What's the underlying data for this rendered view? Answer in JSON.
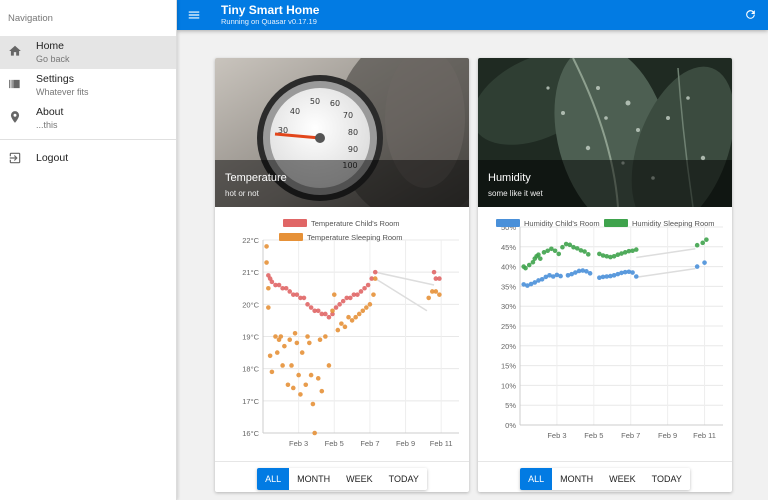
{
  "drawer": {
    "header": "Navigation",
    "items": [
      {
        "label": "Home",
        "sub": "Go back",
        "icon": "home-icon"
      },
      {
        "label": "Settings",
        "sub": "Whatever fits",
        "icon": "settings-icon"
      },
      {
        "label": "About",
        "sub": "...this",
        "icon": "location-pin-icon"
      }
    ],
    "logout": {
      "label": "Logout",
      "icon": "logout-icon"
    }
  },
  "header": {
    "title": "Tiny Smart Home",
    "subtitle": "Running on Quasar v0.17.19",
    "menu_icon": "menu-icon",
    "refresh_icon": "refresh-icon",
    "color": "#027be3"
  },
  "cards": {
    "temperature": {
      "title": "Temperature",
      "subtitle": "hot or not"
    },
    "humidity": {
      "title": "Humidity",
      "subtitle": "some like it wet"
    }
  },
  "range_buttons": [
    "ALL",
    "MONTH",
    "WEEK",
    "TODAY"
  ],
  "chart_data": [
    {
      "type": "scatter",
      "legend_position": "top",
      "grid": true,
      "x_ticks": [
        "Feb 3",
        "Feb 5",
        "Feb 7",
        "Feb 9",
        "Feb 11"
      ],
      "xlim": [
        "Feb 1",
        "Feb 12"
      ],
      "y_ticks": [
        "16°C",
        "17°C",
        "18°C",
        "19°C",
        "20°C",
        "21°C",
        "22°C"
      ],
      "ylim": [
        16,
        22
      ],
      "series": [
        {
          "name": "Temperature Child's Room",
          "color": "#e06666",
          "points": [
            [
              1.3,
              20.9
            ],
            [
              1.4,
              20.8
            ],
            [
              1.5,
              20.7
            ],
            [
              1.7,
              20.6
            ],
            [
              1.9,
              20.6
            ],
            [
              2.1,
              20.5
            ],
            [
              2.3,
              20.5
            ],
            [
              2.5,
              20.4
            ],
            [
              2.7,
              20.3
            ],
            [
              2.9,
              20.3
            ],
            [
              3.1,
              20.2
            ],
            [
              3.3,
              20.2
            ],
            [
              3.5,
              20.0
            ],
            [
              3.7,
              19.9
            ],
            [
              3.9,
              19.8
            ],
            [
              4.1,
              19.8
            ],
            [
              4.3,
              19.7
            ],
            [
              4.5,
              19.7
            ],
            [
              4.7,
              19.6
            ],
            [
              4.9,
              19.7
            ],
            [
              5.1,
              19.9
            ],
            [
              5.3,
              20.0
            ],
            [
              5.5,
              20.1
            ],
            [
              5.7,
              20.2
            ],
            [
              5.9,
              20.2
            ],
            [
              6.1,
              20.3
            ],
            [
              6.3,
              20.3
            ],
            [
              6.5,
              20.4
            ],
            [
              6.7,
              20.5
            ],
            [
              6.9,
              20.6
            ],
            [
              7.1,
              20.8
            ],
            [
              7.3,
              21.0
            ],
            [
              10.6,
              21.0
            ],
            [
              10.7,
              20.8
            ],
            [
              10.9,
              20.8
            ]
          ],
          "trend": [
            [
              7.3,
              21.0
            ],
            [
              10.6,
              20.6
            ]
          ]
        },
        {
          "name": "Temperature Sleeping Room",
          "color": "#e69138",
          "points": [
            [
              1.2,
              21.8
            ],
            [
              1.2,
              21.3
            ],
            [
              1.3,
              20.5
            ],
            [
              1.3,
              19.9
            ],
            [
              1.4,
              18.4
            ],
            [
              1.5,
              17.9
            ],
            [
              1.7,
              19.0
            ],
            [
              1.8,
              18.5
            ],
            [
              1.9,
              18.9
            ],
            [
              2.0,
              19.0
            ],
            [
              2.1,
              18.1
            ],
            [
              2.2,
              18.7
            ],
            [
              2.4,
              17.5
            ],
            [
              2.5,
              18.9
            ],
            [
              2.6,
              18.1
            ],
            [
              2.7,
              17.4
            ],
            [
              2.8,
              19.1
            ],
            [
              2.9,
              18.8
            ],
            [
              3.0,
              17.8
            ],
            [
              3.1,
              17.2
            ],
            [
              3.2,
              18.5
            ],
            [
              3.4,
              17.5
            ],
            [
              3.5,
              19.0
            ],
            [
              3.6,
              18.8
            ],
            [
              3.7,
              17.8
            ],
            [
              3.8,
              16.9
            ],
            [
              3.9,
              16.0
            ],
            [
              4.1,
              17.7
            ],
            [
              4.2,
              18.9
            ],
            [
              4.3,
              17.3
            ],
            [
              4.5,
              19.0
            ],
            [
              4.7,
              18.1
            ],
            [
              4.9,
              19.8
            ],
            [
              5.0,
              20.3
            ],
            [
              5.2,
              19.2
            ],
            [
              5.4,
              19.4
            ],
            [
              5.6,
              19.3
            ],
            [
              5.8,
              19.6
            ],
            [
              6.0,
              19.5
            ],
            [
              6.2,
              19.6
            ],
            [
              6.4,
              19.7
            ],
            [
              6.6,
              19.8
            ],
            [
              6.8,
              19.9
            ],
            [
              7.0,
              20.0
            ],
            [
              7.2,
              20.3
            ],
            [
              7.3,
              20.8
            ],
            [
              10.3,
              20.2
            ],
            [
              10.5,
              20.4
            ],
            [
              10.7,
              20.4
            ],
            [
              10.9,
              20.3
            ]
          ],
          "trend": [
            [
              7.3,
              20.8
            ],
            [
              10.2,
              19.8
            ]
          ]
        }
      ]
    },
    {
      "type": "scatter",
      "legend_position": "top",
      "grid": true,
      "x_ticks": [
        "Feb 3",
        "Feb 5",
        "Feb 7",
        "Feb 9",
        "Feb 11"
      ],
      "xlim": [
        "Feb 1",
        "Feb 12"
      ],
      "y_ticks": [
        "0%",
        "5%",
        "10%",
        "15%",
        "20%",
        "25%",
        "30%",
        "35%",
        "40%",
        "45%",
        "50%"
      ],
      "ylim": [
        0,
        50
      ],
      "series": [
        {
          "name": "Humidity Child's Room",
          "color": "#4a90d9",
          "points": [
            [
              1.2,
              35.5
            ],
            [
              1.4,
              35.2
            ],
            [
              1.6,
              35.6
            ],
            [
              1.8,
              36.0
            ],
            [
              2.0,
              36.5
            ],
            [
              2.2,
              36.8
            ],
            [
              2.4,
              37.4
            ],
            [
              2.6,
              37.8
            ],
            [
              2.8,
              37.5
            ],
            [
              3.0,
              37.9
            ],
            [
              3.2,
              37.6
            ],
            [
              3.6,
              37.8
            ],
            [
              3.8,
              38.1
            ],
            [
              4.0,
              38.5
            ],
            [
              4.2,
              38.9
            ],
            [
              4.4,
              39.0
            ],
            [
              4.6,
              38.8
            ],
            [
              4.8,
              38.3
            ],
            [
              5.3,
              37.2
            ],
            [
              5.5,
              37.4
            ],
            [
              5.7,
              37.5
            ],
            [
              5.9,
              37.6
            ],
            [
              6.1,
              37.8
            ],
            [
              6.3,
              38.1
            ],
            [
              6.5,
              38.4
            ],
            [
              6.7,
              38.6
            ],
            [
              6.9,
              38.7
            ],
            [
              7.1,
              38.5
            ],
            [
              7.3,
              37.5
            ],
            [
              10.6,
              40.0
            ],
            [
              11.0,
              41.0
            ]
          ],
          "trend": [
            [
              7.3,
              37.3
            ],
            [
              10.5,
              39.5
            ]
          ]
        },
        {
          "name": "Humidity Sleeping Room",
          "color": "#3fa34d",
          "points": [
            [
              1.2,
              40.0
            ],
            [
              1.3,
              39.6
            ],
            [
              1.5,
              40.4
            ],
            [
              1.7,
              41.1
            ],
            [
              1.8,
              42.0
            ],
            [
              1.9,
              42.6
            ],
            [
              2.0,
              43.0
            ],
            [
              2.1,
              42.0
            ],
            [
              2.3,
              43.6
            ],
            [
              2.5,
              44.0
            ],
            [
              2.7,
              44.5
            ],
            [
              2.9,
              44.0
            ],
            [
              3.1,
              43.2
            ],
            [
              3.3,
              44.9
            ],
            [
              3.5,
              45.7
            ],
            [
              3.7,
              45.5
            ],
            [
              3.9,
              44.9
            ],
            [
              4.1,
              44.6
            ],
            [
              4.3,
              44.1
            ],
            [
              4.5,
              43.8
            ],
            [
              4.7,
              43.1
            ],
            [
              5.3,
              43.2
            ],
            [
              5.5,
              42.8
            ],
            [
              5.7,
              42.6
            ],
            [
              5.9,
              42.4
            ],
            [
              6.1,
              42.6
            ],
            [
              6.3,
              43.0
            ],
            [
              6.5,
              43.3
            ],
            [
              6.7,
              43.6
            ],
            [
              6.9,
              43.9
            ],
            [
              7.1,
              44.0
            ],
            [
              7.3,
              44.3
            ],
            [
              10.6,
              45.4
            ],
            [
              10.9,
              46.0
            ],
            [
              11.1,
              46.8
            ]
          ],
          "trend": [
            [
              7.3,
              42.3
            ],
            [
              10.5,
              44.5
            ]
          ]
        }
      ]
    }
  ]
}
